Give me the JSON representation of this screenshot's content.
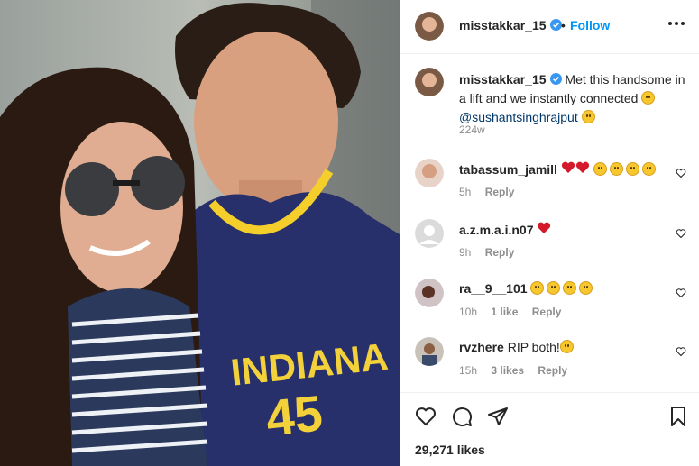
{
  "header": {
    "username": "misstakkar_15",
    "separator": "•",
    "follow_label": "Follow"
  },
  "caption": {
    "username": "misstakkar_15",
    "text": "Met this handsome in a lift and we instantly connected",
    "mention": "@sushantsinghrajput",
    "time": "224w"
  },
  "comments": [
    {
      "username": "tabassum_jamill",
      "time": "5h",
      "reply": "Reply",
      "likes": ""
    },
    {
      "username": "a.z.m.a.i.n07",
      "time": "9h",
      "reply": "Reply",
      "likes": ""
    },
    {
      "username": "ra__9__101",
      "time": "10h",
      "likes": "1 like",
      "reply": "Reply"
    },
    {
      "username": "rvzhere",
      "text": "RIP both!",
      "time": "15h",
      "likes": "3 likes",
      "reply": "Reply"
    }
  ],
  "likes": "29,271 likes",
  "colors": {
    "accent": "#0095f6",
    "verified": "#3897f0",
    "text": "#262626",
    "muted": "#8e8e8e"
  },
  "icons": [
    "verified-badge-icon",
    "more-options-icon",
    "heart-icon",
    "comment-icon",
    "share-icon",
    "bookmark-icon"
  ]
}
